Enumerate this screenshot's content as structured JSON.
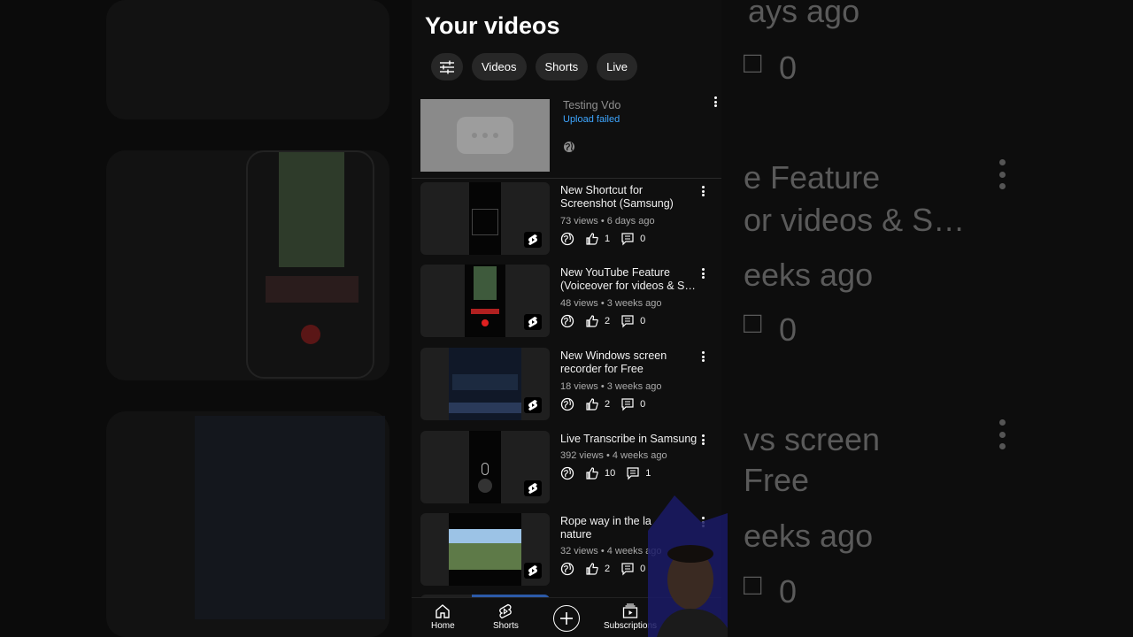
{
  "page": {
    "title": "Your videos"
  },
  "filters": {
    "chips": [
      "Videos",
      "Shorts",
      "Live"
    ]
  },
  "failed_upload": {
    "title": "Testing Vdo",
    "status": "Upload failed"
  },
  "videos": [
    {
      "title_line1": "New Shortcut for",
      "title_line2": "Screenshot (Samsung)",
      "meta": "73 views • 6 days ago",
      "likes": "1",
      "comments": "0"
    },
    {
      "title_line1": "New YouTube Feature",
      "title_line2": "(Voiceover for videos & S…",
      "meta": "48 views • 3 weeks ago",
      "likes": "2",
      "comments": "0"
    },
    {
      "title_line1": "New Windows screen",
      "title_line2": "recorder for Free",
      "meta": "18 views • 3 weeks ago",
      "likes": "2",
      "comments": "0"
    },
    {
      "title_line1": "Live Transcribe in Samsung",
      "title_line2": "",
      "meta": "392 views • 4 weeks ago",
      "likes": "10",
      "comments": "1"
    },
    {
      "title_line1": "Rope way in the la",
      "title_line2": "nature",
      "meta": "32 views • 4 weeks ago",
      "likes": "2",
      "comments": "0"
    }
  ],
  "nav": {
    "home": "Home",
    "shorts": "Shorts",
    "subscriptions": "Subscriptions"
  },
  "background": {
    "right_lines": [
      "ays ago",
      "0",
      "e Feature",
      "or videos & S…",
      "eeks ago",
      "0",
      "vs screen",
      "Free",
      "eeks ago",
      "0"
    ]
  },
  "colors": {
    "accent_link": "#3ea6ff",
    "surface": "#0f0f0f",
    "chip": "#272727"
  }
}
